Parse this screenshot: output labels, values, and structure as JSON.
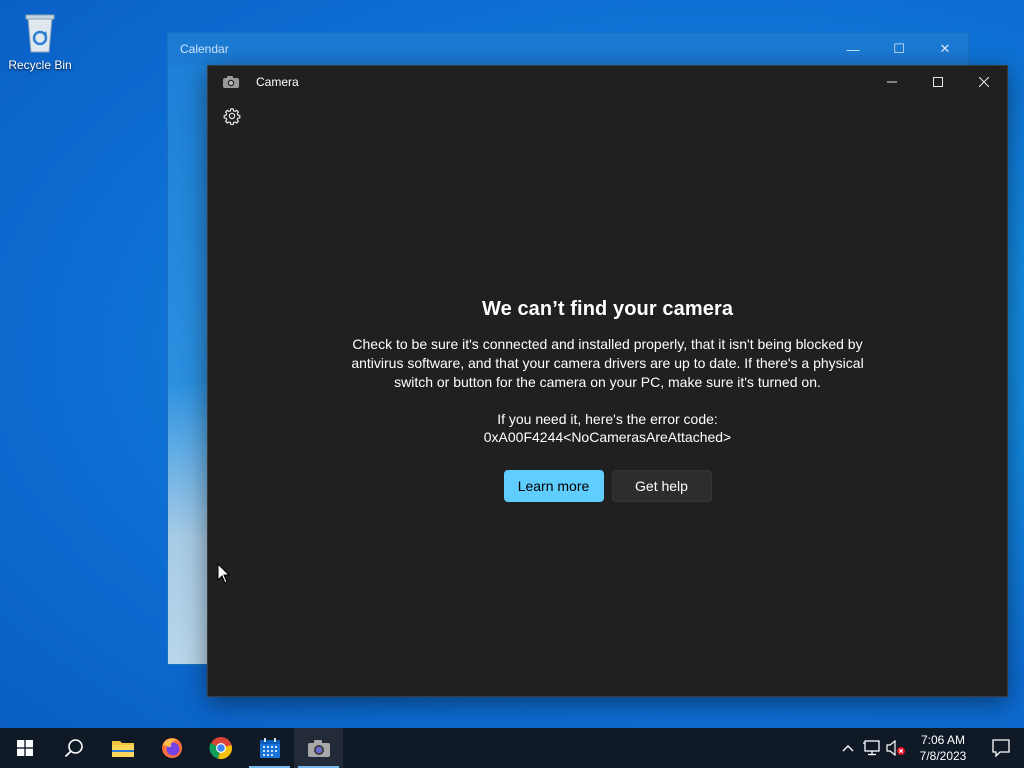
{
  "desktop": {
    "icons": [
      {
        "label": "Recycle Bin",
        "icon": "recycle-bin-icon"
      }
    ]
  },
  "calendar_window": {
    "title": "Calendar",
    "controls": {
      "minimize": "—",
      "maximize": "☐",
      "close": "✕"
    }
  },
  "camera_window": {
    "title": "Camera",
    "app_icon": "camera-icon",
    "settings_icon": "gear-icon",
    "heading": "We can’t find your camera",
    "body": "Check to be sure it's connected and installed properly, that it isn't being blocked by antivirus software, and that your camera drivers are up to date. If there's a physical switch or button for the camera on your PC, make sure it's turned on.",
    "error_intro": "If you need it, here's the error code:",
    "error_code": "0xA00F4244<NoCamerasAreAttached>",
    "buttons": {
      "learn_more": "Learn more",
      "get_help": "Get help"
    },
    "accent_color": "#60cdff"
  },
  "taskbar": {
    "items": [
      "start-icon",
      "search-icon",
      "file-explorer-icon",
      "firefox-icon",
      "chrome-icon",
      "calendar-icon",
      "camera-icon"
    ],
    "tray": {
      "icons": [
        "chevron-up-icon",
        "network-icon",
        "volume-muted-icon"
      ],
      "time": "7:06 AM",
      "date": "7/8/2023",
      "notification_icon": "notification-icon"
    }
  }
}
